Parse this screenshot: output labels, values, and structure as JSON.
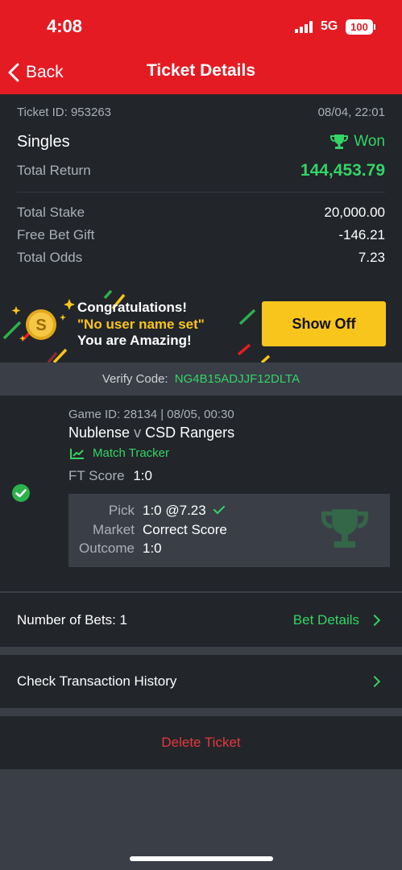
{
  "status_bar": {
    "time": "4:08",
    "network": "5G",
    "battery": "100"
  },
  "nav": {
    "back_label": "Back",
    "title": "Ticket Details"
  },
  "ticket": {
    "id_text": "Ticket ID: 953263",
    "date": "08/04, 22:01",
    "type": "Singles",
    "status": "Won",
    "total_return_label": "Total Return",
    "total_return": "144,453.79",
    "total_stake_label": "Total Stake",
    "total_stake": "20,000.00",
    "free_bet_label": "Free Bet Gift",
    "free_bet": "-146.21",
    "total_odds_label": "Total Odds",
    "total_odds": "7.23"
  },
  "banner": {
    "line1": "Congratulations!",
    "line2": "\"No user name set\"",
    "line3": "You are Amazing!",
    "button": "Show Off"
  },
  "verify": {
    "label": "Verify Code:",
    "code": "NG4B15ADJJF12DLTA"
  },
  "bet": {
    "game_info": "Game ID: 28134 | 08/05, 00:30",
    "home": "Nublense",
    "vs": "v",
    "away": "CSD Rangers",
    "tracker_label": "Match Tracker",
    "ft_label": "FT Score",
    "ft_score": "1:0",
    "pick_label": "Pick",
    "pick_value": "1:0 @7.23",
    "market_label": "Market",
    "market_value": "Correct Score",
    "outcome_label": "Outcome",
    "outcome_value": "1:0"
  },
  "bets_row": {
    "label": "Number of Bets: 1",
    "link": "Bet Details"
  },
  "history_row": {
    "label": "Check Transaction History"
  },
  "delete": {
    "label": "Delete Ticket"
  },
  "colors": {
    "brand_red": "#e41b23",
    "win_green": "#33d466",
    "accent_yellow": "#f8c51c",
    "panel": "#22252a",
    "background": "#3a3e47"
  }
}
